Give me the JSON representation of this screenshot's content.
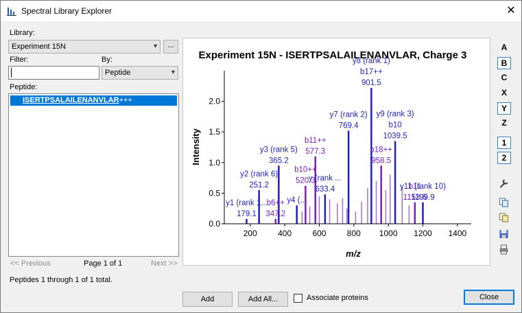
{
  "window": {
    "title": "Spectral Library Explorer",
    "close_glyph": "✕"
  },
  "library": {
    "label": "Library:",
    "selected": "Experiment 15N",
    "browse": "..."
  },
  "filter": {
    "label": "Filter:",
    "value": "",
    "by_label": "By:",
    "by_value": "Peptide"
  },
  "peptide_list": {
    "label": "Peptide:",
    "selected_item": "ISERTPSALAILENANVLAR",
    "selected_charge": "+++"
  },
  "pager": {
    "previous": "<< Previous",
    "page": "Page 1 of 1",
    "next": "Next >>"
  },
  "status": "Peptides 1 through 1 of 1 total.",
  "buttons": {
    "add": "Add",
    "add_all": "Add All...",
    "associate": "Associate proteins",
    "close": "Close"
  },
  "ion_toggles": [
    {
      "label": "A",
      "on": false
    },
    {
      "label": "B",
      "on": true
    },
    {
      "label": "C",
      "on": false
    },
    {
      "label": "X",
      "on": false
    },
    {
      "label": "Y",
      "on": true
    },
    {
      "label": "Z",
      "on": false
    },
    {
      "label": "1",
      "on": true
    },
    {
      "label": "2",
      "on": true
    }
  ],
  "tool_icons": [
    "wrench-icon",
    "copy-icon",
    "copy-metafile-icon",
    "save-icon",
    "print-icon"
  ],
  "colors": {
    "y_ion": "#1f1fbf",
    "b_ion": "#7a1fbf",
    "other": "#a070c8",
    "selection": "#0078d7"
  },
  "chart_data": {
    "type": "bar",
    "title": "Experiment 15N - ISERTPSALAILENANVLAR, Charge 3",
    "xlabel": "m/z",
    "ylabel": "Intensity",
    "xlim": [
      50,
      1480
    ],
    "ylim": [
      0,
      2.5
    ],
    "xticks": [
      "200",
      "400",
      "600",
      "800",
      "1000",
      "1200",
      "1400"
    ],
    "yticks": [
      "0.0",
      "0.5",
      "1.0",
      "1.5",
      "2.0"
    ],
    "peaks": [
      {
        "mz": 179.1,
        "intensity": 0.08,
        "ion": "y",
        "lines": [
          "y1 (rank 1...",
          "179.1"
        ]
      },
      {
        "mz": 251.2,
        "intensity": 0.55,
        "ion": "y",
        "lines": [
          "y2 (rank 6)",
          "251.2"
        ]
      },
      {
        "mz": 347.2,
        "intensity": 0.08,
        "ion": "b",
        "lines": [
          "b6++",
          "347.2"
        ]
      },
      {
        "mz": 365.2,
        "intensity": 0.95,
        "ion": "y",
        "lines": [
          "y3 (rank 5)",
          "365.2"
        ]
      },
      {
        "mz": 470,
        "intensity": 0.3,
        "ion": "y",
        "lines": [
          "y4 (..."
        ]
      },
      {
        "mz": 520.3,
        "intensity": 0.62,
        "ion": "b",
        "lines": [
          "b10++",
          "520.3"
        ]
      },
      {
        "mz": 577.3,
        "intensity": 1.1,
        "ion": "b",
        "lines": [
          "b11++",
          "577.3"
        ]
      },
      {
        "mz": 633.4,
        "intensity": 0.48,
        "ion": "y",
        "lines": [
          "y (rank ...",
          "633.4"
        ]
      },
      {
        "mz": 769.4,
        "intensity": 1.52,
        "ion": "y",
        "lines": [
          "y7 (rank 2)",
          "769.4"
        ]
      },
      {
        "mz": 901.5,
        "intensity": 2.22,
        "ion": "y",
        "lines": [
          "y8 (rank 1)",
          "b17++",
          "901.5"
        ]
      },
      {
        "mz": 958.5,
        "intensity": 0.95,
        "ion": "b",
        "lines": [
          "b18++",
          "958.5"
        ]
      },
      {
        "mz": 1039.5,
        "intensity": 1.35,
        "ion": "y",
        "lines": [
          "y9 (rank 3)",
          "b10",
          "1039.5"
        ]
      },
      {
        "mz": 1153.6,
        "intensity": 0.35,
        "ion": "b",
        "lines": [
          "b11",
          "1153.6"
        ]
      },
      {
        "mz": 1199.9,
        "intensity": 0.35,
        "ion": "y",
        "lines": [
          "y11 (rank 10)",
          "1199.9"
        ]
      }
    ],
    "minor_peaks": [
      {
        "mz": 470,
        "intensity": 0.12
      },
      {
        "mz": 500,
        "intensity": 0.2
      },
      {
        "mz": 545,
        "intensity": 0.28
      },
      {
        "mz": 600,
        "intensity": 0.45
      },
      {
        "mz": 660,
        "intensity": 0.4
      },
      {
        "mz": 705,
        "intensity": 0.33
      },
      {
        "mz": 735,
        "intensity": 0.42
      },
      {
        "mz": 760,
        "intensity": 0.25
      },
      {
        "mz": 810,
        "intensity": 0.2
      },
      {
        "mz": 845,
        "intensity": 0.36
      },
      {
        "mz": 880,
        "intensity": 0.58
      },
      {
        "mz": 930,
        "intensity": 0.7
      },
      {
        "mz": 985,
        "intensity": 0.55
      },
      {
        "mz": 1010,
        "intensity": 0.8
      },
      {
        "mz": 1080,
        "intensity": 0.6
      },
      {
        "mz": 1120,
        "intensity": 0.3
      }
    ]
  }
}
